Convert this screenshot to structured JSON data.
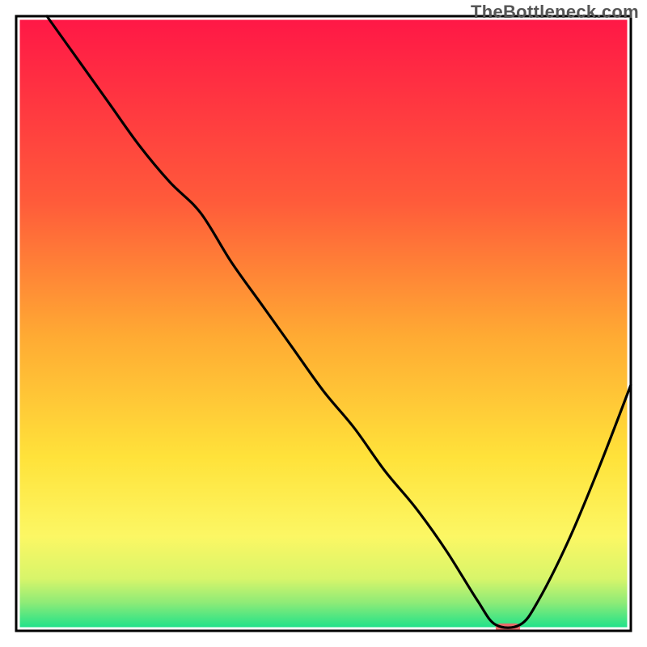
{
  "watermark": "TheBottleneck.com",
  "chart_data": {
    "type": "line",
    "title": "",
    "xlabel": "",
    "ylabel": "",
    "xlim": [
      0,
      100
    ],
    "ylim": [
      0,
      100
    ],
    "grid": false,
    "legend": {
      "visible": false
    },
    "annotations": [
      {
        "text": "TheBottleneck.com",
        "position": "top-right"
      }
    ],
    "background_gradient_stops": [
      {
        "offset": 0.0,
        "color": "#ff1846"
      },
      {
        "offset": 0.3,
        "color": "#ff5b3a"
      },
      {
        "offset": 0.52,
        "color": "#ffaa33"
      },
      {
        "offset": 0.72,
        "color": "#ffe23a"
      },
      {
        "offset": 0.85,
        "color": "#fcf764"
      },
      {
        "offset": 0.92,
        "color": "#d8f56a"
      },
      {
        "offset": 0.96,
        "color": "#8deb77"
      },
      {
        "offset": 1.0,
        "color": "#21e28a"
      }
    ],
    "series": [
      {
        "name": "bottleneck-curve",
        "color": "#000000",
        "x": [
          5,
          10,
          15,
          20,
          25,
          30,
          35,
          40,
          45,
          50,
          55,
          60,
          65,
          70,
          75,
          78,
          82,
          85,
          90,
          95,
          100
        ],
        "y": [
          100,
          93,
          86,
          79,
          73,
          68,
          60,
          53,
          46,
          39,
          33,
          26,
          20,
          13,
          5,
          1,
          1,
          5,
          15,
          27,
          40
        ]
      }
    ],
    "marker": {
      "name": "optimal-marker",
      "color": "#e96a6a",
      "x": 80,
      "y": 0.5,
      "width_pct": 4,
      "height_pct": 1.4
    },
    "border": {
      "color": "#000000",
      "width": 3
    }
  }
}
